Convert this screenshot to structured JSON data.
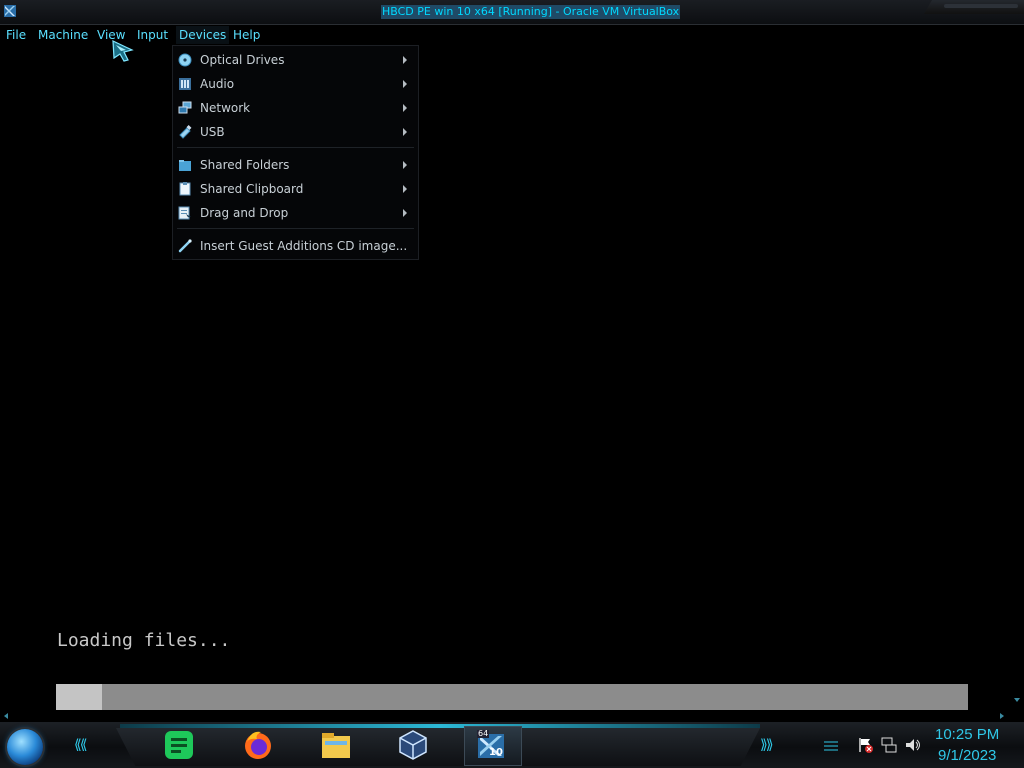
{
  "window": {
    "title": "HBCD PE win 10 x64 [Running] - Oracle VM VirtualBox"
  },
  "menubar": {
    "items": [
      "File",
      "Machine",
      "View",
      "Input",
      "Devices",
      "Help"
    ],
    "active": "Devices"
  },
  "devices_menu": {
    "groups": [
      [
        {
          "label": "Optical Drives",
          "icon": "optical-disc-icon",
          "submenu": true
        },
        {
          "label": "Audio",
          "icon": "audio-icon",
          "submenu": true
        },
        {
          "label": "Network",
          "icon": "network-icon",
          "submenu": true
        },
        {
          "label": "USB",
          "icon": "usb-icon",
          "submenu": true
        }
      ],
      [
        {
          "label": "Shared Folders",
          "icon": "shared-folders-icon",
          "submenu": true
        },
        {
          "label": "Shared Clipboard",
          "icon": "clipboard-icon",
          "submenu": true
        },
        {
          "label": "Drag and Drop",
          "icon": "drag-drop-icon",
          "submenu": true
        }
      ],
      [
        {
          "label": "Insert Guest Additions CD image...",
          "icon": "guest-additions-cd-icon",
          "submenu": false
        }
      ]
    ]
  },
  "guest": {
    "status_text": "Loading files...",
    "progress_fraction": 0.05
  },
  "taskbar": {
    "apps": [
      "start-orb",
      "notes-app-icon",
      "firefox-icon",
      "file-explorer-icon",
      "virtualbox-icon",
      "hbcd-vm-window-icon"
    ],
    "vbox_badge_top": "64",
    "vbox_badge_bottom": "10",
    "clock": {
      "time": "10:25 PM",
      "date": "9/1/2023"
    }
  },
  "colors": {
    "accent": "#2fc8e8",
    "menu_text": "#5ae0ff",
    "title_text": "#00d8ff",
    "progress_bg": "#8c8c8c",
    "progress_fill": "#c4c4c4"
  }
}
